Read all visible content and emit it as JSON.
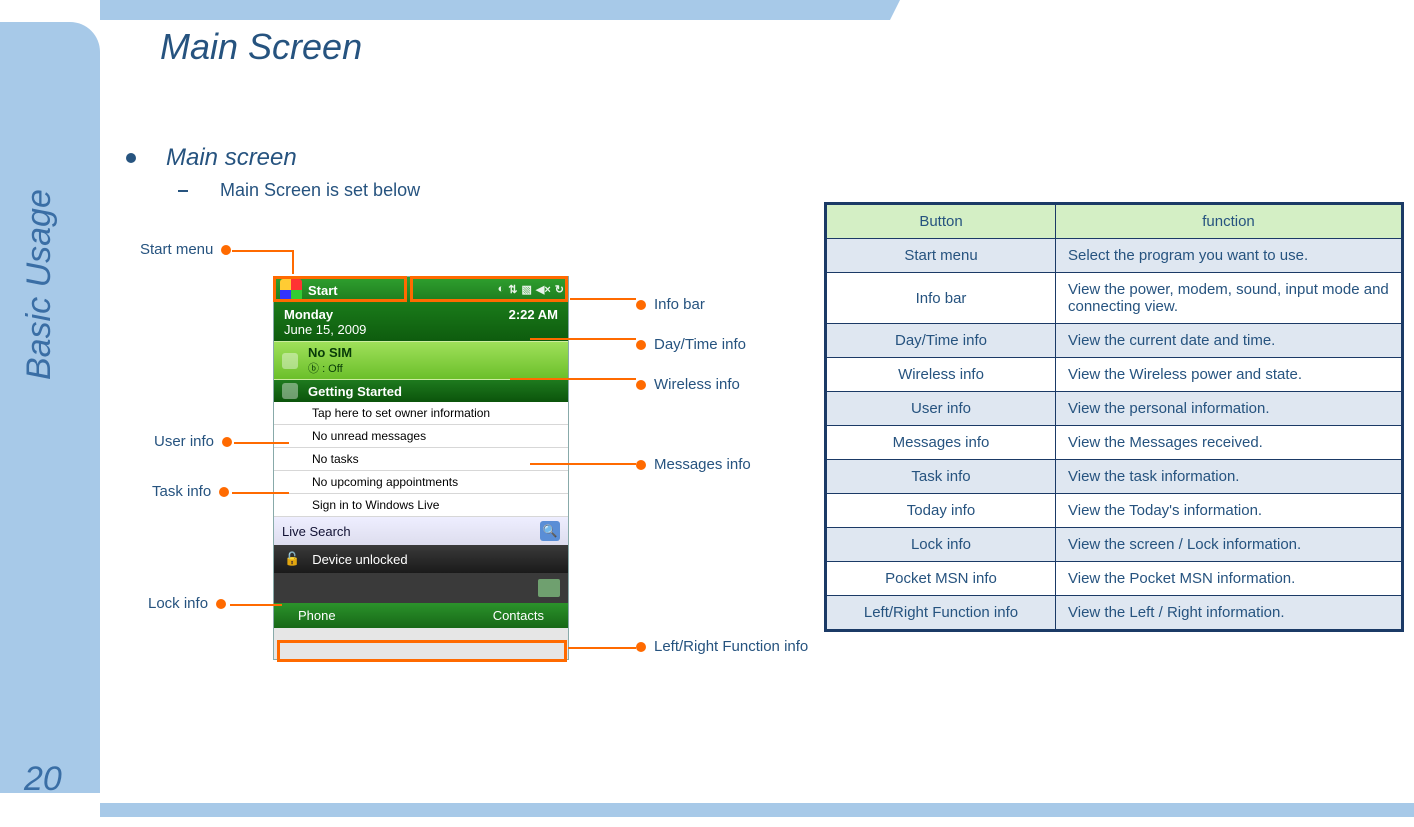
{
  "page": {
    "title": "Main Screen",
    "sidebar_label": "Basic Usage",
    "page_number": "20"
  },
  "bullets": {
    "main": "Main screen",
    "sub": "Main Screen is set below"
  },
  "phone": {
    "start_label": "Start",
    "time": "2:22 AM",
    "day": "Monday",
    "date": "June 15, 2009",
    "sim": "No SIM",
    "bt": ": Off",
    "getting": "Getting Started",
    "owner": "Tap here to set owner information",
    "messages": "No unread messages",
    "tasks": "No tasks",
    "appts": "No upcoming appointments",
    "live": "Sign in to Windows Live",
    "livesearch": "Live Search",
    "unlocked": "Device unlocked",
    "soft_left": "Phone",
    "soft_right": "Contacts"
  },
  "callouts": {
    "start": "Start menu",
    "info": "Info bar",
    "daytime": "Day/Time info",
    "wireless": "Wireless info",
    "user": "User info",
    "task": "Task info",
    "lock": "Lock info",
    "mess": "Messages info",
    "lr": "Left/Right Function info"
  },
  "table": {
    "h1": "Button",
    "h2": "function",
    "rows": [
      {
        "b": "Start menu",
        "f": "Select the program you want to use."
      },
      {
        "b": "Info bar",
        "f": "View the power, modem, sound, input mode and connecting view."
      },
      {
        "b": "Day/Time info",
        "f": "View the current date and time."
      },
      {
        "b": "Wireless info",
        "f": "View the Wireless power and state."
      },
      {
        "b": "User info",
        "f": "View the personal information."
      },
      {
        "b": "Messages info",
        "f": "View the Messages received."
      },
      {
        "b": "Task info",
        "f": "View the task information."
      },
      {
        "b": "Today info",
        "f": "View the Today's information."
      },
      {
        "b": "Lock info",
        "f": "View the screen / Lock information."
      },
      {
        "b": "Pocket MSN info",
        "f": "View the Pocket MSN information."
      },
      {
        "b": "Left/Right Function info",
        "f": "View the Left / Right information."
      }
    ]
  }
}
